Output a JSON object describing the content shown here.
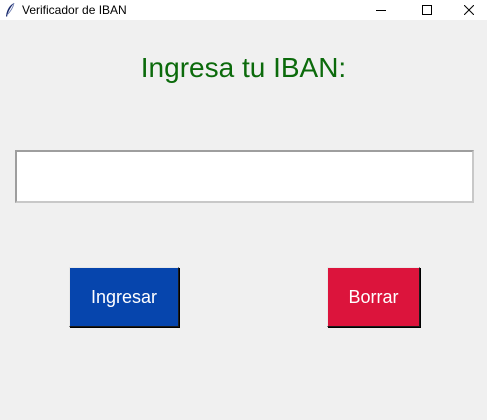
{
  "window": {
    "title": "Verificador de IBAN",
    "icon": "feather-icon"
  },
  "heading": "Ingresa tu IBAN:",
  "iban_input": {
    "value": "",
    "placeholder": ""
  },
  "buttons": {
    "ingresar_label": "Ingresar",
    "borrar_label": "Borrar"
  },
  "colors": {
    "heading": "#0b6a0b",
    "ingresar_bg": "#0645ad",
    "borrar_bg": "#dc143c",
    "background": "#f0f0f0"
  }
}
